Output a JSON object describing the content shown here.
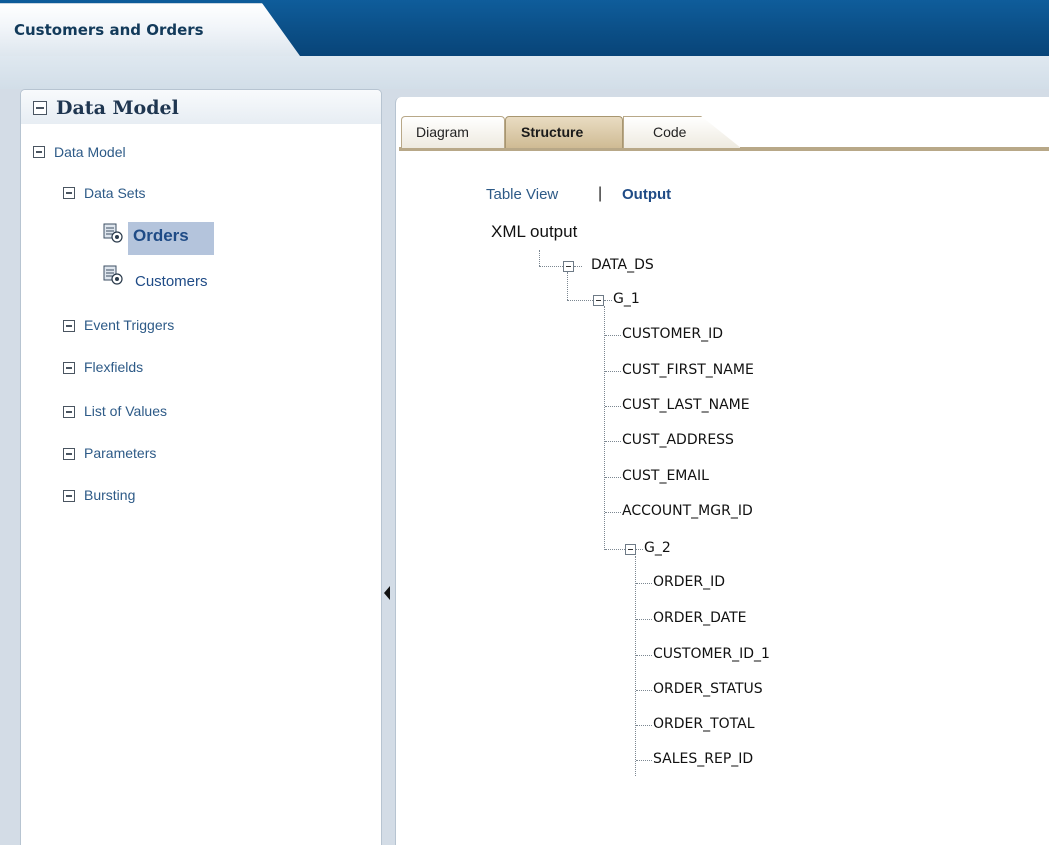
{
  "window": {
    "tab_title": "Customers and Orders"
  },
  "left_panel": {
    "header_title": "Data Model",
    "tree": {
      "root_label": "Data Model",
      "data_sets_label": "Data Sets",
      "data_sets": [
        {
          "label": "Orders",
          "selected": true
        },
        {
          "label": "Customers",
          "selected": false
        }
      ],
      "sections": [
        "Event Triggers",
        "Flexfields",
        "List of Values",
        "Parameters",
        "Bursting"
      ]
    }
  },
  "right_panel": {
    "tabs": [
      {
        "label": "Diagram",
        "active": false
      },
      {
        "label": "Structure",
        "active": true
      },
      {
        "label": "Code",
        "active": false
      }
    ],
    "view_links": {
      "table_view": "Table View",
      "separator": "|",
      "output": "Output"
    },
    "xml_title": "XML output",
    "xml_tree": {
      "root": "DATA_DS",
      "group1": "G_1",
      "group1_fields": [
        "CUSTOMER_ID",
        "CUST_FIRST_NAME",
        "CUST_LAST_NAME",
        "CUST_ADDRESS",
        "CUST_EMAIL",
        "ACCOUNT_MGR_ID"
      ],
      "group2": "G_2",
      "group2_fields": [
        "ORDER_ID",
        "ORDER_DATE",
        "CUSTOMER_ID_1",
        "ORDER_STATUS",
        "ORDER_TOTAL",
        "SALES_REP_ID"
      ]
    }
  },
  "colors": {
    "banner": "#0b4f87",
    "link": "#2d5a87",
    "selection": "#b4c4dc",
    "tab_active": "#cfbb94"
  }
}
